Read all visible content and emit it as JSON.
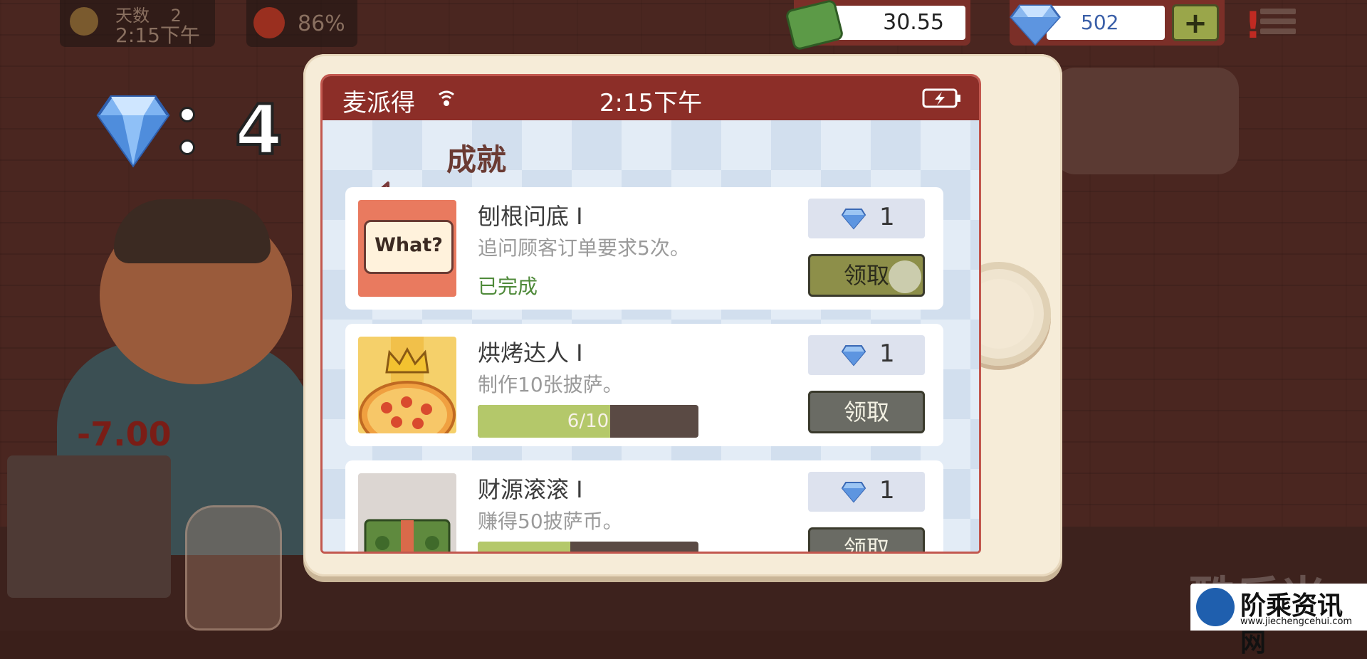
{
  "hud": {
    "day_label": "天数",
    "day_number": "2",
    "time": "2:15下午",
    "mood_percent": "86%",
    "money": "30.55",
    "gems": "502",
    "add_gems_label": "+"
  },
  "reward_popup": {
    "count": "4"
  },
  "background": {
    "penalty": "-7.00",
    "faded_watermark": "酷乐米"
  },
  "phone": {
    "carrier": "麦派得",
    "clock": "2:15下午",
    "page_title": "成就",
    "achievements": [
      {
        "title": "刨根问底 Ⅰ",
        "description": "追问顾客订单要求5次。",
        "status": "已完成",
        "reward": "1",
        "claim_label": "领取",
        "image_text": "What?"
      },
      {
        "title": "烘烤达人 Ⅰ",
        "description": "制作10张披萨。",
        "progress_text": "6/10",
        "progress": 0.6,
        "reward": "1",
        "claim_label": "领取"
      },
      {
        "title": "财源滚滚 Ⅰ",
        "description": "赚得50披萨币。",
        "progress": 0.42,
        "reward": "1",
        "claim_label": "领取"
      }
    ]
  },
  "watermark": {
    "name": "阶乘资讯网",
    "url": "www.jiechengcehui.com"
  },
  "colors": {
    "status_bar": "#8c2e28",
    "claim_active": "#8d8f49",
    "progress_fill": "#b4c86a"
  }
}
